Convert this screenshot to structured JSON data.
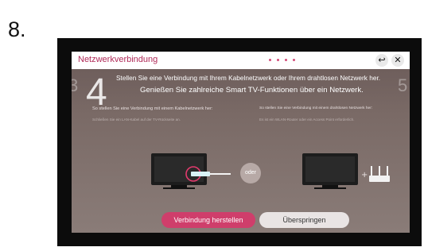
{
  "step_number": "8.",
  "window": {
    "title": "Netzwerkverbindung",
    "back_glyph": "↩",
    "close_glyph": "✕",
    "back_icon": "back-icon",
    "close_icon": "close-icon"
  },
  "pager": {
    "previous": "3",
    "current": "4",
    "next": "5"
  },
  "heading": {
    "line1": "Stellen Sie eine Verbindung mit Ihrem Kabelnetzwerk oder Ihrem drahtlosen Netzwerk her.",
    "line2": "Genießen Sie zahlreiche Smart TV-Funktionen über ein Netzwerk."
  },
  "options": {
    "wired": {
      "title": "So stellen Sie eine Verbindung mit einem Kabelnetzwerk her:",
      "subtitle": "Schließen Sie ein LAN-Kabel auf der TV-Rückseite an."
    },
    "wireless": {
      "title": "So stellen Sie eine Verbindung mit einem drahtlosen Netzwerk her:",
      "subtitle": "Es ist ein WLAN-Router oder ein Access Point erforderlich."
    },
    "separator": "oder"
  },
  "buttons": {
    "connect": "Verbindung herstellen",
    "skip": "Überspringen"
  },
  "colors": {
    "accent": "#cf3e6b",
    "title_color": "#b02a58",
    "background": "#0c0c0c"
  },
  "icons": [
    "tv-wired-icon",
    "lan-cable-icon",
    "tv-wireless-icon",
    "router-icon"
  ]
}
